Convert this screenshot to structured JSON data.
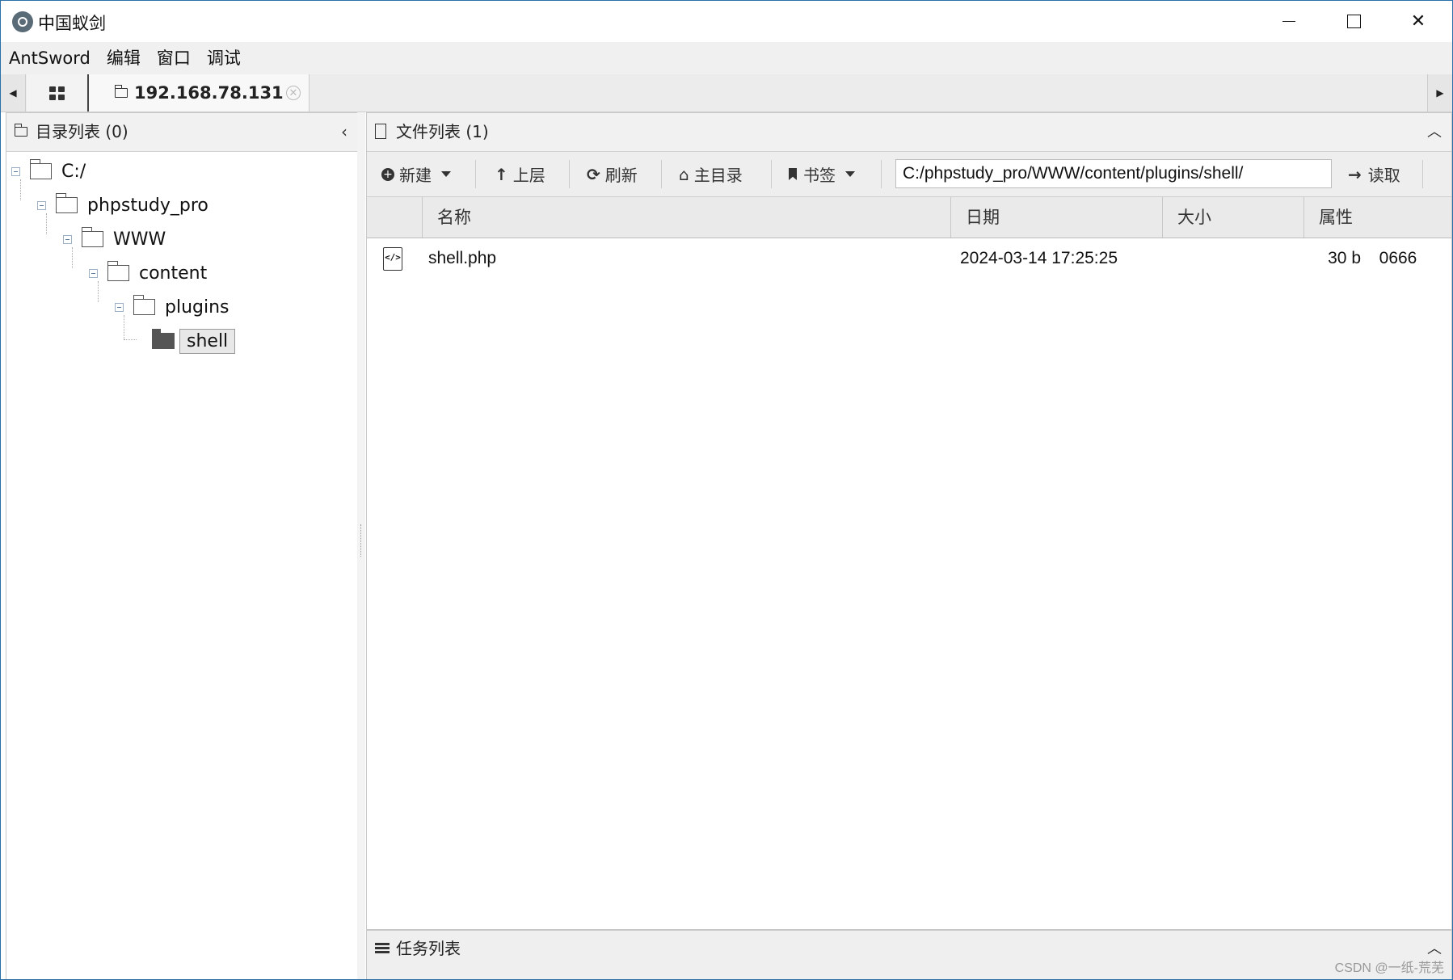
{
  "window": {
    "title": "中国蚁剑"
  },
  "menu": [
    "AntSword",
    "编辑",
    "窗口",
    "调试"
  ],
  "tabs": {
    "active_label": "192.168.78.131"
  },
  "left_panel": {
    "title": "目录列表 (0)",
    "tree": [
      {
        "label": "C:/",
        "level": 0
      },
      {
        "label": "phpstudy_pro",
        "level": 1
      },
      {
        "label": "WWW",
        "level": 2
      },
      {
        "label": "content",
        "level": 3
      },
      {
        "label": "plugins",
        "level": 4
      },
      {
        "label": "shell",
        "level": 5,
        "selected": true
      }
    ]
  },
  "right_panel": {
    "title": "文件列表 (1)",
    "toolbar": {
      "new": "新建",
      "up": "上层",
      "refresh": "刷新",
      "home": "主目录",
      "bookmark": "书签",
      "path": "C:/phpstudy_pro/WWW/content/plugins/shell/",
      "read": "读取"
    },
    "columns": [
      "名称",
      "日期",
      "大小",
      "属性"
    ],
    "files": [
      {
        "name": "shell.php",
        "date": "2024-03-14 17:25:25",
        "size": "30 b",
        "attr": "0666"
      }
    ]
  },
  "task_panel": {
    "title": "任务列表"
  },
  "watermark": "CSDN @一纸-荒芜"
}
